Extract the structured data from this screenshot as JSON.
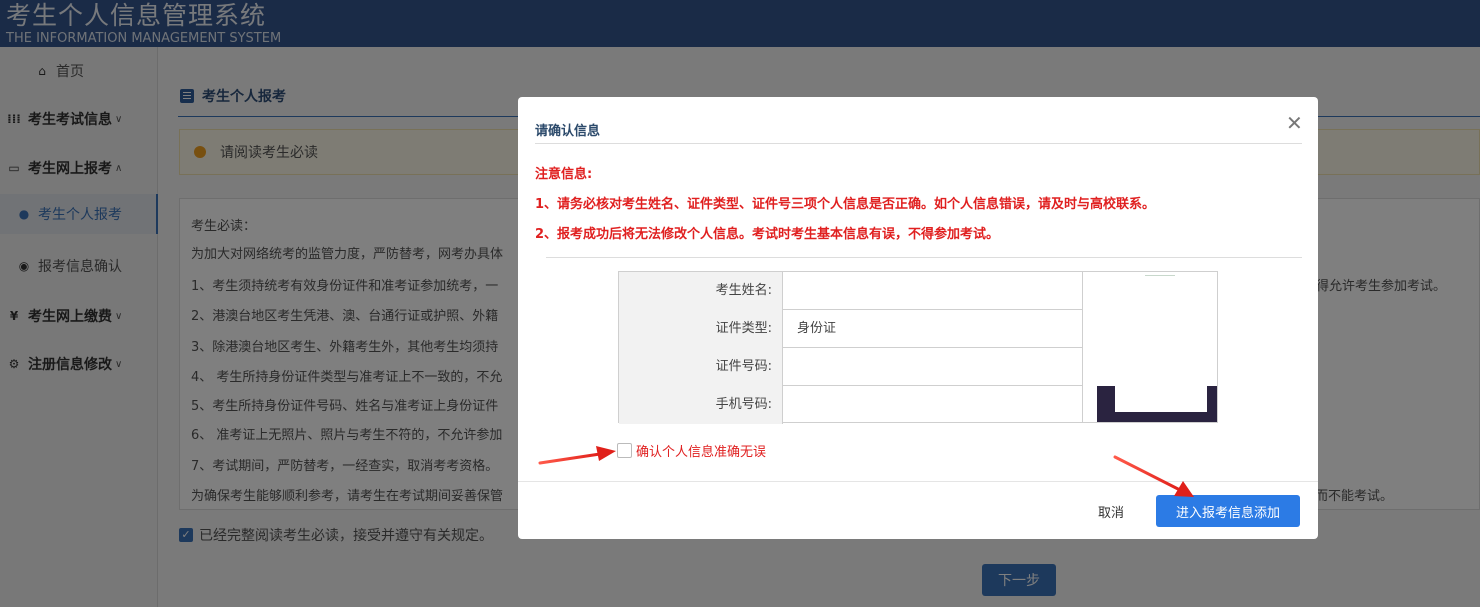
{
  "header": {
    "title": "考生个人信息管理系统",
    "subtitle": "THE INFORMATION MANAGEMENT SYSTEM"
  },
  "sidebar": {
    "items": [
      {
        "label": "首页",
        "icon": "home-icon"
      },
      {
        "label": "考生考试信息",
        "icon": "grid-icon"
      },
      {
        "label": "考生网上报考",
        "icon": "monitor-icon"
      },
      {
        "label": "考生个人报考",
        "icon": "user-add-icon"
      },
      {
        "label": "报考信息确认",
        "icon": "check-circle-icon"
      },
      {
        "label": "考生网上缴费",
        "icon": "yen-icon"
      },
      {
        "label": "注册信息修改",
        "icon": "gear-icon"
      }
    ]
  },
  "main": {
    "title": "考生个人报考",
    "notice": "请阅读考生必读",
    "read_lines": [
      "考生必读：",
      "为加大对网络统考的监管力度，严防替考，网考办具体",
      "1、考生须持统考有效身份证件和准考证参加统考，一",
      "2、港澳台地区考生凭港、澳、台通行证或护照、外籍",
      "3、除港澳台地区考生、外籍考生外，其他考生均须持",
      "4、 考生所持身份证件类型与准考证上不一致的，不允",
      "5、考生所持身份证件号码、姓名与准考证上身份证件",
      "6、 准考证上无照片、照片与考生不符的，不允许参加",
      "7、考试期间，严防替考，一经查实，取消考考资格。",
      "为确保考生能够顺利参考，请考生在考试期间妥善保管"
    ],
    "read_right_1": "得允许考生参加考试。",
    "read_right_2": "而不能考试。",
    "agree_label": "已经完整阅读考生必读，接受并遵守有关规定。",
    "next_label": "下一步"
  },
  "modal": {
    "title": "请确认信息",
    "warn_title": "注意信息:",
    "warn_1": "1、请务必核对考生姓名、证件类型、证件号三项个人信息是否正确。如个人信息错误，请及时与高校联系。",
    "warn_2": "2、报考成功后将无法修改个人信息。考试时考生基本信息有误，不得参加考试。",
    "fields": [
      {
        "label": "考生姓名:",
        "value": ""
      },
      {
        "label": "证件类型:",
        "value": "身份证"
      },
      {
        "label": "证件号码:",
        "value": ""
      },
      {
        "label": "手机号码:",
        "value": ""
      }
    ],
    "confirm_label": "确认个人信息准确无误",
    "cancel_label": "取消",
    "submit_label": "进入报考信息添加"
  },
  "colors": {
    "header_bg": "#35578f",
    "accent": "#3b73b9",
    "warn_red": "#e02020",
    "primary_button": "#2c7be5"
  }
}
